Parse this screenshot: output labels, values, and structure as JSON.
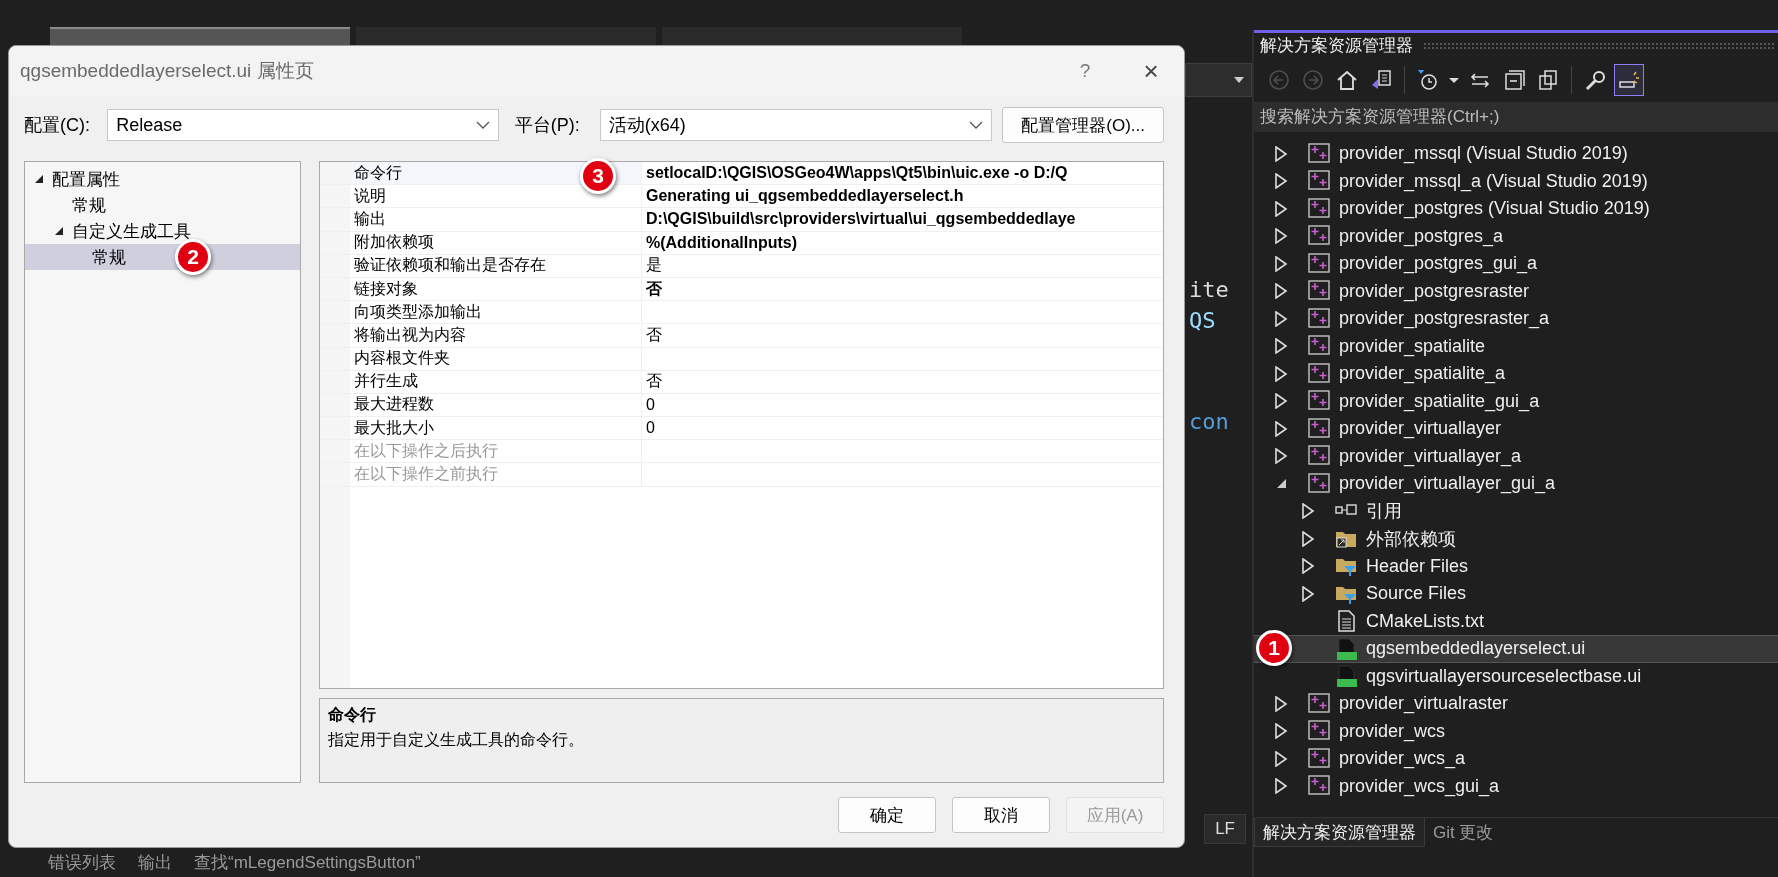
{
  "editor": {
    "tabs": [
      {
        "selected": true
      },
      {
        "selected": false
      },
      {
        "selected": false
      }
    ],
    "code_fragments": [
      {
        "text": "ite",
        "kind": "plain"
      },
      {
        "text": "QS",
        "kind": "type"
      },
      {
        "text": "con",
        "kind": "keyword"
      }
    ],
    "line_ending": "LF"
  },
  "bottom_tabs": [
    "错误列表",
    "输出",
    "查找“mLegendSettingsButton”"
  ],
  "dialog": {
    "title": "qgsembeddedlayerselect.ui 属性页",
    "help": "?",
    "close": "×",
    "config_label": "配置(C):",
    "config_value": "Release",
    "platform_label": "平台(P):",
    "platform_value": "活动(x64)",
    "config_manager": "配置管理器(O)...",
    "tree": [
      {
        "label": "配置属性",
        "expanded": true,
        "selected": false,
        "children": [
          {
            "label": "常规",
            "selected": false
          },
          {
            "label": "自定义生成工具",
            "expanded": true,
            "selected": false,
            "children": [
              {
                "label": "常规",
                "selected": true,
                "callout": "2"
              }
            ]
          }
        ]
      }
    ],
    "properties": [
      {
        "name": "命令行",
        "value": "setlocalD:\\QGIS\\OSGeo4W\\apps\\Qt5\\bin\\uic.exe -o D:/Q",
        "bold": true,
        "disabled": false,
        "selected": true,
        "callout": "3"
      },
      {
        "name": "说明",
        "value": "Generating ui_qgsembeddedlayerselect.h",
        "bold": true,
        "disabled": false,
        "selected": false
      },
      {
        "name": "输出",
        "value": "D:\\QGIS\\build\\src\\providers\\virtual\\ui_qgsembeddedlaye",
        "bold": true,
        "disabled": false,
        "selected": false
      },
      {
        "name": "附加依赖项",
        "value": "%(AdditionalInputs)",
        "bold": true,
        "disabled": false,
        "selected": false
      },
      {
        "name": "验证依赖项和输出是否存在",
        "value": "是",
        "bold": false,
        "disabled": false,
        "selected": false
      },
      {
        "name": "链接对象",
        "value": "否",
        "bold": true,
        "disabled": false,
        "selected": false
      },
      {
        "name": "向项类型添加输出",
        "disabled": false,
        "selected": false
      },
      {
        "name": "将输出视为内容",
        "value": "否",
        "bold": false,
        "disabled": false,
        "selected": false
      },
      {
        "name": "内容根文件夹",
        "disabled": false,
        "selected": false
      },
      {
        "name": "并行生成",
        "value": "否",
        "bold": false,
        "disabled": false,
        "selected": false
      },
      {
        "name": "最大进程数",
        "value": "0",
        "bold": false,
        "disabled": false,
        "selected": false
      },
      {
        "name": "最大批大小",
        "value": "0",
        "bold": false,
        "disabled": false,
        "selected": false
      },
      {
        "name": "在以下操作之后执行",
        "disabled": true,
        "selected": false
      },
      {
        "name": "在以下操作之前执行",
        "disabled": true,
        "selected": false
      }
    ],
    "description": {
      "title": "命令行",
      "text": "指定用于自定义生成工具的命令行。"
    },
    "buttons": [
      {
        "label": "确定",
        "disabled": false
      },
      {
        "label": "取消",
        "disabled": false
      },
      {
        "label": "应用(A)",
        "disabled": true
      }
    ]
  },
  "explorer": {
    "title": "解决方案资源管理器",
    "toolbar": [
      {
        "kind": "back",
        "disabled": true,
        "on": false
      },
      {
        "kind": "forward",
        "disabled": true,
        "on": false
      },
      {
        "kind": "home",
        "disabled": false,
        "on": false
      },
      {
        "kind": "switch-views",
        "disabled": false,
        "on": false
      },
      {
        "kind": "pending-changes",
        "disabled": false,
        "on": false
      },
      {
        "kind": "dropdown",
        "disabled": false,
        "on": false
      },
      {
        "kind": "sync",
        "disabled": false,
        "on": false
      },
      {
        "kind": "collapse",
        "disabled": false,
        "on": false
      },
      {
        "kind": "show-all",
        "disabled": false,
        "on": false
      },
      {
        "kind": "properties",
        "disabled": false,
        "on": false
      },
      {
        "kind": "preview",
        "disabled": false,
        "on": true
      }
    ],
    "search_placeholder": "搜索解决方案资源管理器(Ctrl+;)",
    "tree": [
      {
        "label": "provider_mssql (Visual Studio 2019)",
        "kind": "project",
        "expanded": false,
        "selected": false
      },
      {
        "label": "provider_mssql_a (Visual Studio 2019)",
        "kind": "project",
        "expanded": false,
        "selected": false
      },
      {
        "label": "provider_postgres (Visual Studio 2019)",
        "kind": "project",
        "expanded": false,
        "selected": false
      },
      {
        "label": "provider_postgres_a",
        "kind": "project",
        "expanded": false,
        "selected": false
      },
      {
        "label": "provider_postgres_gui_a",
        "kind": "project",
        "expanded": false,
        "selected": false
      },
      {
        "label": "provider_postgresraster",
        "kind": "project",
        "expanded": false,
        "selected": false
      },
      {
        "label": "provider_postgresraster_a",
        "kind": "project",
        "expanded": false,
        "selected": false
      },
      {
        "label": "provider_spatialite",
        "kind": "project",
        "expanded": false,
        "selected": false
      },
      {
        "label": "provider_spatialite_a",
        "kind": "project",
        "expanded": false,
        "selected": false
      },
      {
        "label": "provider_spatialite_gui_a",
        "kind": "project",
        "expanded": false,
        "selected": false
      },
      {
        "label": "provider_virtuallayer",
        "kind": "project",
        "expanded": false,
        "selected": false
      },
      {
        "label": "provider_virtuallayer_a",
        "kind": "project",
        "expanded": false,
        "selected": false
      },
      {
        "label": "provider_virtuallayer_gui_a",
        "kind": "project",
        "expanded": true,
        "selected": false,
        "children": [
          {
            "label": "引用",
            "kind": "references",
            "expanded": false,
            "selected": false
          },
          {
            "label": "外部依赖项",
            "kind": "external",
            "expanded": false,
            "selected": false
          },
          {
            "label": "Header Files",
            "kind": "filter",
            "expanded": false,
            "selected": false
          },
          {
            "label": "Source Files",
            "kind": "filter",
            "expanded": false,
            "selected": false
          },
          {
            "label": "CMakeLists.txt",
            "kind": "text-file",
            "selected": false
          },
          {
            "label": "qgsembeddedlayerselect.ui",
            "kind": "ui-file",
            "selected": true,
            "callout": "1"
          },
          {
            "label": "qgsvirtuallayersourceselectbase.ui",
            "kind": "ui-file",
            "selected": false
          }
        ]
      },
      {
        "label": "provider_virtualraster",
        "kind": "project",
        "expanded": false,
        "selected": false
      },
      {
        "label": "provider_wcs",
        "kind": "project",
        "expanded": false,
        "selected": false
      },
      {
        "label": "provider_wcs_a",
        "kind": "project",
        "expanded": false,
        "selected": false
      },
      {
        "label": "provider_wcs_gui_a",
        "kind": "project",
        "expanded": false,
        "selected": false
      }
    ],
    "tabs": [
      {
        "label": "解决方案资源管理器",
        "selected": true
      },
      {
        "label": "Git 更改",
        "selected": false
      }
    ]
  }
}
